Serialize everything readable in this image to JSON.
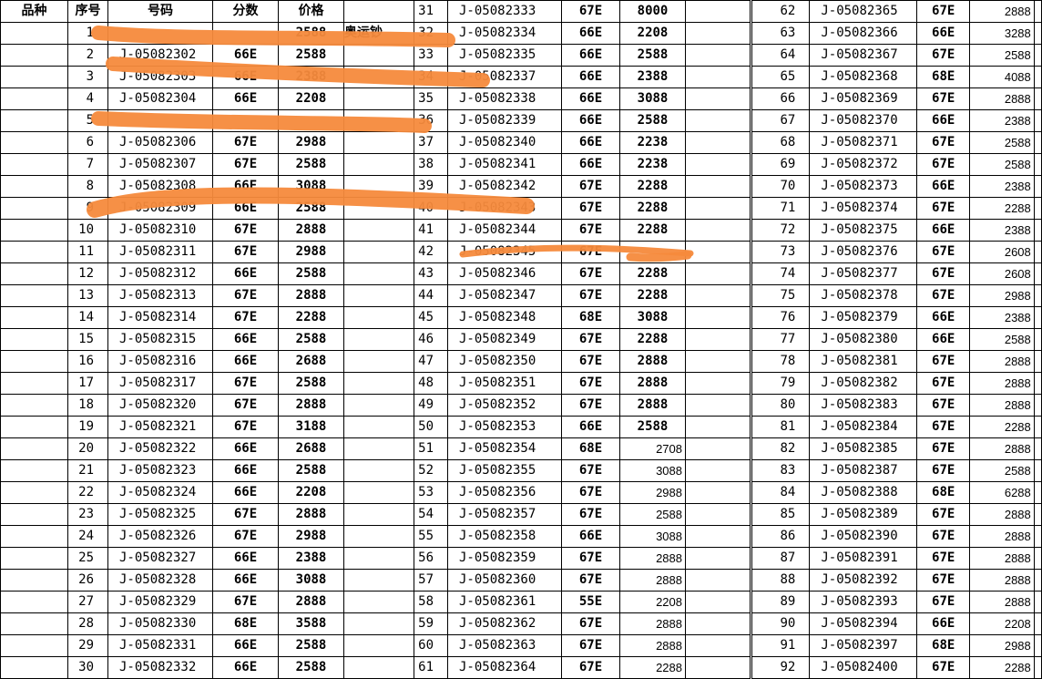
{
  "headers": {
    "category": "品种",
    "seq": "序号",
    "code": "号码",
    "score": "分数",
    "price": "价格"
  },
  "block1_note": "奥运钞",
  "colors": {
    "black": "#000000",
    "red": "#e00000",
    "blue": "#0aa0c8",
    "green": "#139a3a",
    "highlighter": "#f58a3c"
  },
  "rows_block1": [
    {
      "seq": "1",
      "code": "",
      "score": "",
      "price": "2588",
      "color": "black"
    },
    {
      "seq": "2",
      "code": "J-05082302",
      "score": "66E",
      "price": "2588",
      "color": "black"
    },
    {
      "seq": "3",
      "code": "J-05082303",
      "score": "66E",
      "price": "2388",
      "color": "black"
    },
    {
      "seq": "4",
      "code": "J-05082304",
      "score": "66E",
      "price": "2208",
      "color": "black"
    },
    {
      "seq": "5",
      "code": "",
      "score": "",
      "price": "",
      "color": "black"
    },
    {
      "seq": "6",
      "code": "J-05082306",
      "score": "67E",
      "price": "2988",
      "color": "red"
    },
    {
      "seq": "7",
      "code": "J-05082307",
      "score": "67E",
      "price": "2588",
      "color": "red"
    },
    {
      "seq": "8",
      "code": "J-05082308",
      "score": "66E",
      "price": "3088",
      "color": "black"
    },
    {
      "seq": "9",
      "code": "J-05082309",
      "score": "66E",
      "price": "2588",
      "color": "black"
    },
    {
      "seq": "10",
      "code": "J-05082310",
      "score": "67E",
      "price": "2888",
      "color": "red"
    },
    {
      "seq": "11",
      "code": "J-05082311",
      "score": "67E",
      "price": "2988",
      "color": "red"
    },
    {
      "seq": "12",
      "code": "J-05082312",
      "score": "66E",
      "price": "2588",
      "color": "black"
    },
    {
      "seq": "13",
      "code": "J-05082313",
      "score": "67E",
      "price": "2888",
      "color": "red"
    },
    {
      "seq": "14",
      "code": "J-05082314",
      "score": "67E",
      "price": "2288",
      "color": "red"
    },
    {
      "seq": "15",
      "code": "J-05082315",
      "score": "66E",
      "price": "2588",
      "color": "black"
    },
    {
      "seq": "16",
      "code": "J-05082316",
      "score": "66E",
      "price": "2688",
      "color": "black"
    },
    {
      "seq": "17",
      "code": "J-05082317",
      "score": "67E",
      "price": "2588",
      "color": "red"
    },
    {
      "seq": "18",
      "code": "J-05082320",
      "score": "67E",
      "price": "2888",
      "color": "red"
    },
    {
      "seq": "19",
      "code": "J-05082321",
      "score": "67E",
      "price": "3188",
      "color": "red"
    },
    {
      "seq": "20",
      "code": "J-05082322",
      "score": "66E",
      "price": "2688",
      "color": "black"
    },
    {
      "seq": "21",
      "code": "J-05082323",
      "score": "66E",
      "price": "2588",
      "color": "black"
    },
    {
      "seq": "22",
      "code": "J-05082324",
      "score": "66E",
      "price": "2208",
      "color": "black"
    },
    {
      "seq": "23",
      "code": "J-05082325",
      "score": "67E",
      "price": "2888",
      "color": "red"
    },
    {
      "seq": "24",
      "code": "J-05082326",
      "score": "67E",
      "price": "2988",
      "color": "red"
    },
    {
      "seq": "25",
      "code": "J-05082327",
      "score": "66E",
      "price": "2388",
      "color": "black"
    },
    {
      "seq": "26",
      "code": "J-05082328",
      "score": "66E",
      "price": "3088",
      "color": "black"
    },
    {
      "seq": "27",
      "code": "J-05082329",
      "score": "67E",
      "price": "2888",
      "color": "red"
    },
    {
      "seq": "28",
      "code": "J-05082330",
      "score": "68E",
      "price": "3588",
      "color": "blue"
    },
    {
      "seq": "29",
      "code": "J-05082331",
      "score": "66E",
      "price": "2588",
      "color": "black"
    },
    {
      "seq": "30",
      "code": "J-05082332",
      "score": "66E",
      "price": "2588",
      "color": "black"
    }
  ],
  "rows_block2": [
    {
      "seq": "31",
      "code": "J-05082333",
      "score": "67E",
      "price": "8000",
      "color": "red",
      "small": false
    },
    {
      "seq": "32",
      "code": "J-05082334",
      "score": "66E",
      "price": "2208",
      "color": "black",
      "small": false
    },
    {
      "seq": "33",
      "code": "J-05082335",
      "score": "66E",
      "price": "2588",
      "color": "black",
      "small": false
    },
    {
      "seq": "34",
      "code": "J-05082337",
      "score": "66E",
      "price": "2388",
      "color": "black",
      "small": false
    },
    {
      "seq": "35",
      "code": "J-05082338",
      "score": "66E",
      "price": "3088",
      "color": "black",
      "small": false
    },
    {
      "seq": "36",
      "code": "J-05082339",
      "score": "66E",
      "price": "2588",
      "color": "black",
      "small": false
    },
    {
      "seq": "37",
      "code": "J-05082340",
      "score": "66E",
      "price": "2238",
      "color": "black",
      "small": false
    },
    {
      "seq": "38",
      "code": "J-05082341",
      "score": "66E",
      "price": "2238",
      "color": "black",
      "small": false
    },
    {
      "seq": "39",
      "code": "J-05082342",
      "score": "67E",
      "price": "2288",
      "color": "red",
      "small": false
    },
    {
      "seq": "40",
      "code": "J-05082343",
      "score": "67E",
      "price": "2288",
      "color": "red",
      "small": false
    },
    {
      "seq": "41",
      "code": "J-05082344",
      "score": "67E",
      "price": "2288",
      "color": "red",
      "small": false
    },
    {
      "seq": "42",
      "code": "J-05082345",
      "score": "67E",
      "price": "",
      "color": "red",
      "small": false
    },
    {
      "seq": "43",
      "code": "J-05082346",
      "score": "67E",
      "price": "2288",
      "color": "red",
      "small": false
    },
    {
      "seq": "44",
      "code": "J-05082347",
      "score": "67E",
      "price": "2288",
      "color": "red",
      "small": false
    },
    {
      "seq": "45",
      "code": "J-05082348",
      "score": "68E",
      "price": "3088",
      "color": "blue",
      "small": false
    },
    {
      "seq": "46",
      "code": "J-05082349",
      "score": "67E",
      "price": "2288",
      "color": "red",
      "small": false
    },
    {
      "seq": "47",
      "code": "J-05082350",
      "score": "67E",
      "price": "2888",
      "color": "red",
      "small": false
    },
    {
      "seq": "48",
      "code": "J-05082351",
      "score": "67E",
      "price": "2888",
      "color": "red",
      "small": false
    },
    {
      "seq": "49",
      "code": "J-05082352",
      "score": "67E",
      "price": "2888",
      "color": "red",
      "small": false
    },
    {
      "seq": "50",
      "code": "J-05082353",
      "score": "66E",
      "price": "2588",
      "color": "black",
      "small": false
    },
    {
      "seq": "51",
      "code": "J-05082354",
      "score": "68E",
      "price": "2708",
      "color": "blue",
      "small": true
    },
    {
      "seq": "52",
      "code": "J-05082355",
      "score": "67E",
      "price": "3088",
      "color": "red",
      "small": true
    },
    {
      "seq": "53",
      "code": "J-05082356",
      "score": "67E",
      "price": "2988",
      "color": "red",
      "small": true
    },
    {
      "seq": "54",
      "code": "J-05082357",
      "score": "67E",
      "price": "2588",
      "color": "red",
      "small": true
    },
    {
      "seq": "55",
      "code": "J-05082358",
      "score": "66E",
      "price": "3088",
      "color": "black",
      "small": true
    },
    {
      "seq": "56",
      "code": "J-05082359",
      "score": "67E",
      "price": "2888",
      "color": "red",
      "small": true
    },
    {
      "seq": "57",
      "code": "J-05082360",
      "score": "67E",
      "price": "2888",
      "color": "red",
      "small": true
    },
    {
      "seq": "58",
      "code": "J-05082361",
      "score": "55E",
      "price": "2208",
      "color": "green",
      "small": true
    },
    {
      "seq": "59",
      "code": "J-05082362",
      "score": "67E",
      "price": "2888",
      "color": "red",
      "small": true
    },
    {
      "seq": "60",
      "code": "J-05082363",
      "score": "67E",
      "price": "2888",
      "color": "red",
      "small": true
    },
    {
      "seq": "61",
      "code": "J-05082364",
      "score": "67E",
      "price": "2288",
      "color": "red",
      "small": true
    }
  ],
  "rows_block3": [
    {
      "seq": "62",
      "code": "J-05082365",
      "score": "67E",
      "price": "2888",
      "color": "red"
    },
    {
      "seq": "63",
      "code": "J-05082366",
      "score": "66E",
      "price": "3288",
      "color": "black"
    },
    {
      "seq": "64",
      "code": "J-05082367",
      "score": "67E",
      "price": "2588",
      "color": "red"
    },
    {
      "seq": "65",
      "code": "J-05082368",
      "score": "68E",
      "price": "4088",
      "color": "blue"
    },
    {
      "seq": "66",
      "code": "J-05082369",
      "score": "67E",
      "price": "2888",
      "color": "red"
    },
    {
      "seq": "67",
      "code": "J-05082370",
      "score": "66E",
      "price": "2388",
      "color": "black"
    },
    {
      "seq": "68",
      "code": "J-05082371",
      "score": "67E",
      "price": "2588",
      "color": "red"
    },
    {
      "seq": "69",
      "code": "J-05082372",
      "score": "67E",
      "price": "2588",
      "color": "red"
    },
    {
      "seq": "70",
      "code": "J-05082373",
      "score": "66E",
      "price": "2388",
      "color": "black"
    },
    {
      "seq": "71",
      "code": "J-05082374",
      "score": "67E",
      "price": "2288",
      "color": "red"
    },
    {
      "seq": "72",
      "code": "J-05082375",
      "score": "66E",
      "price": "2388",
      "color": "black"
    },
    {
      "seq": "73",
      "code": "J-05082376",
      "score": "67E",
      "price": "2608",
      "color": "red"
    },
    {
      "seq": "74",
      "code": "J-05082377",
      "score": "67E",
      "price": "2608",
      "color": "red"
    },
    {
      "seq": "75",
      "code": "J-05082378",
      "score": "67E",
      "price": "2988",
      "color": "red"
    },
    {
      "seq": "76",
      "code": "J-05082379",
      "score": "66E",
      "price": "2388",
      "color": "black"
    },
    {
      "seq": "77",
      "code": "J-05082380",
      "score": "66E",
      "price": "2588",
      "color": "black"
    },
    {
      "seq": "78",
      "code": "J-05082381",
      "score": "67E",
      "price": "2888",
      "color": "red"
    },
    {
      "seq": "79",
      "code": "J-05082382",
      "score": "67E",
      "price": "2888",
      "color": "red"
    },
    {
      "seq": "80",
      "code": "J-05082383",
      "score": "67E",
      "price": "2888",
      "color": "red"
    },
    {
      "seq": "81",
      "code": "J-05082384",
      "score": "67E",
      "price": "2288",
      "color": "red"
    },
    {
      "seq": "82",
      "code": "J-05082385",
      "score": "67E",
      "price": "2888",
      "color": "red"
    },
    {
      "seq": "83",
      "code": "J-05082387",
      "score": "67E",
      "price": "2588",
      "color": "red"
    },
    {
      "seq": "84",
      "code": "J-05082388",
      "score": "68E",
      "price": "6288",
      "color": "blue"
    },
    {
      "seq": "85",
      "code": "J-05082389",
      "score": "67E",
      "price": "2888",
      "color": "red"
    },
    {
      "seq": "86",
      "code": "J-05082390",
      "score": "67E",
      "price": "2888",
      "color": "red"
    },
    {
      "seq": "87",
      "code": "J-05082391",
      "score": "67E",
      "price": "2888",
      "color": "red"
    },
    {
      "seq": "88",
      "code": "J-05082392",
      "score": "67E",
      "price": "2888",
      "color": "red"
    },
    {
      "seq": "89",
      "code": "J-05082393",
      "score": "67E",
      "price": "2888",
      "color": "red"
    },
    {
      "seq": "90",
      "code": "J-05082394",
      "score": "66E",
      "price": "2208",
      "color": "black"
    },
    {
      "seq": "91",
      "code": "J-05082397",
      "score": "68E",
      "price": "2988",
      "color": "blue"
    },
    {
      "seq": "92",
      "code": "J-05082400",
      "score": "67E",
      "price": "2288",
      "color": "red"
    }
  ]
}
